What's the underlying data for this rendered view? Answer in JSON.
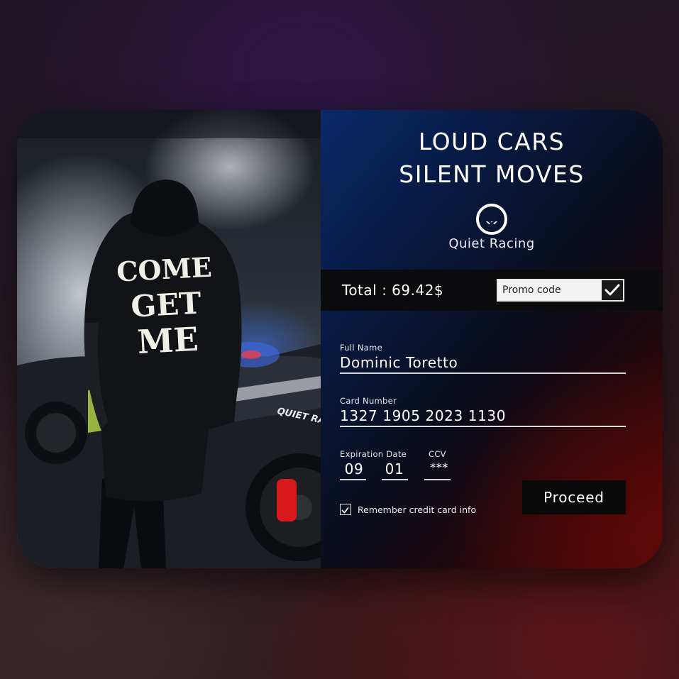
{
  "photo": {
    "hoodie_text": [
      "COME",
      "GET",
      "ME"
    ],
    "car_text": "QUIET RAC"
  },
  "headline": {
    "line1": "LOUD CARS",
    "line2": "SILENT MOVES"
  },
  "brand": {
    "logo_icon": "muted-face-x-icon",
    "name": "Quiet Racing"
  },
  "order": {
    "total_label": "Total : 69.42$",
    "promo_placeholder": "Promo code",
    "promo_icon": "checkmark-icon"
  },
  "form": {
    "full_name": {
      "label": "Full Name",
      "value": "Dominic Toretto"
    },
    "card_number": {
      "label": "Card Number",
      "value": "1327 1905 2023 1130"
    },
    "expiration": {
      "label": "Expiration Date",
      "month": "09",
      "year": "01"
    },
    "ccv": {
      "label": "CCV",
      "value": "***"
    },
    "remember": {
      "label": "Remember credit card info",
      "checked": true
    },
    "proceed_label": "Proceed"
  },
  "colors": {
    "panel_blue": "#0b2a6a",
    "panel_red": "#5e0808",
    "button_bg": "#0a0a0a"
  }
}
